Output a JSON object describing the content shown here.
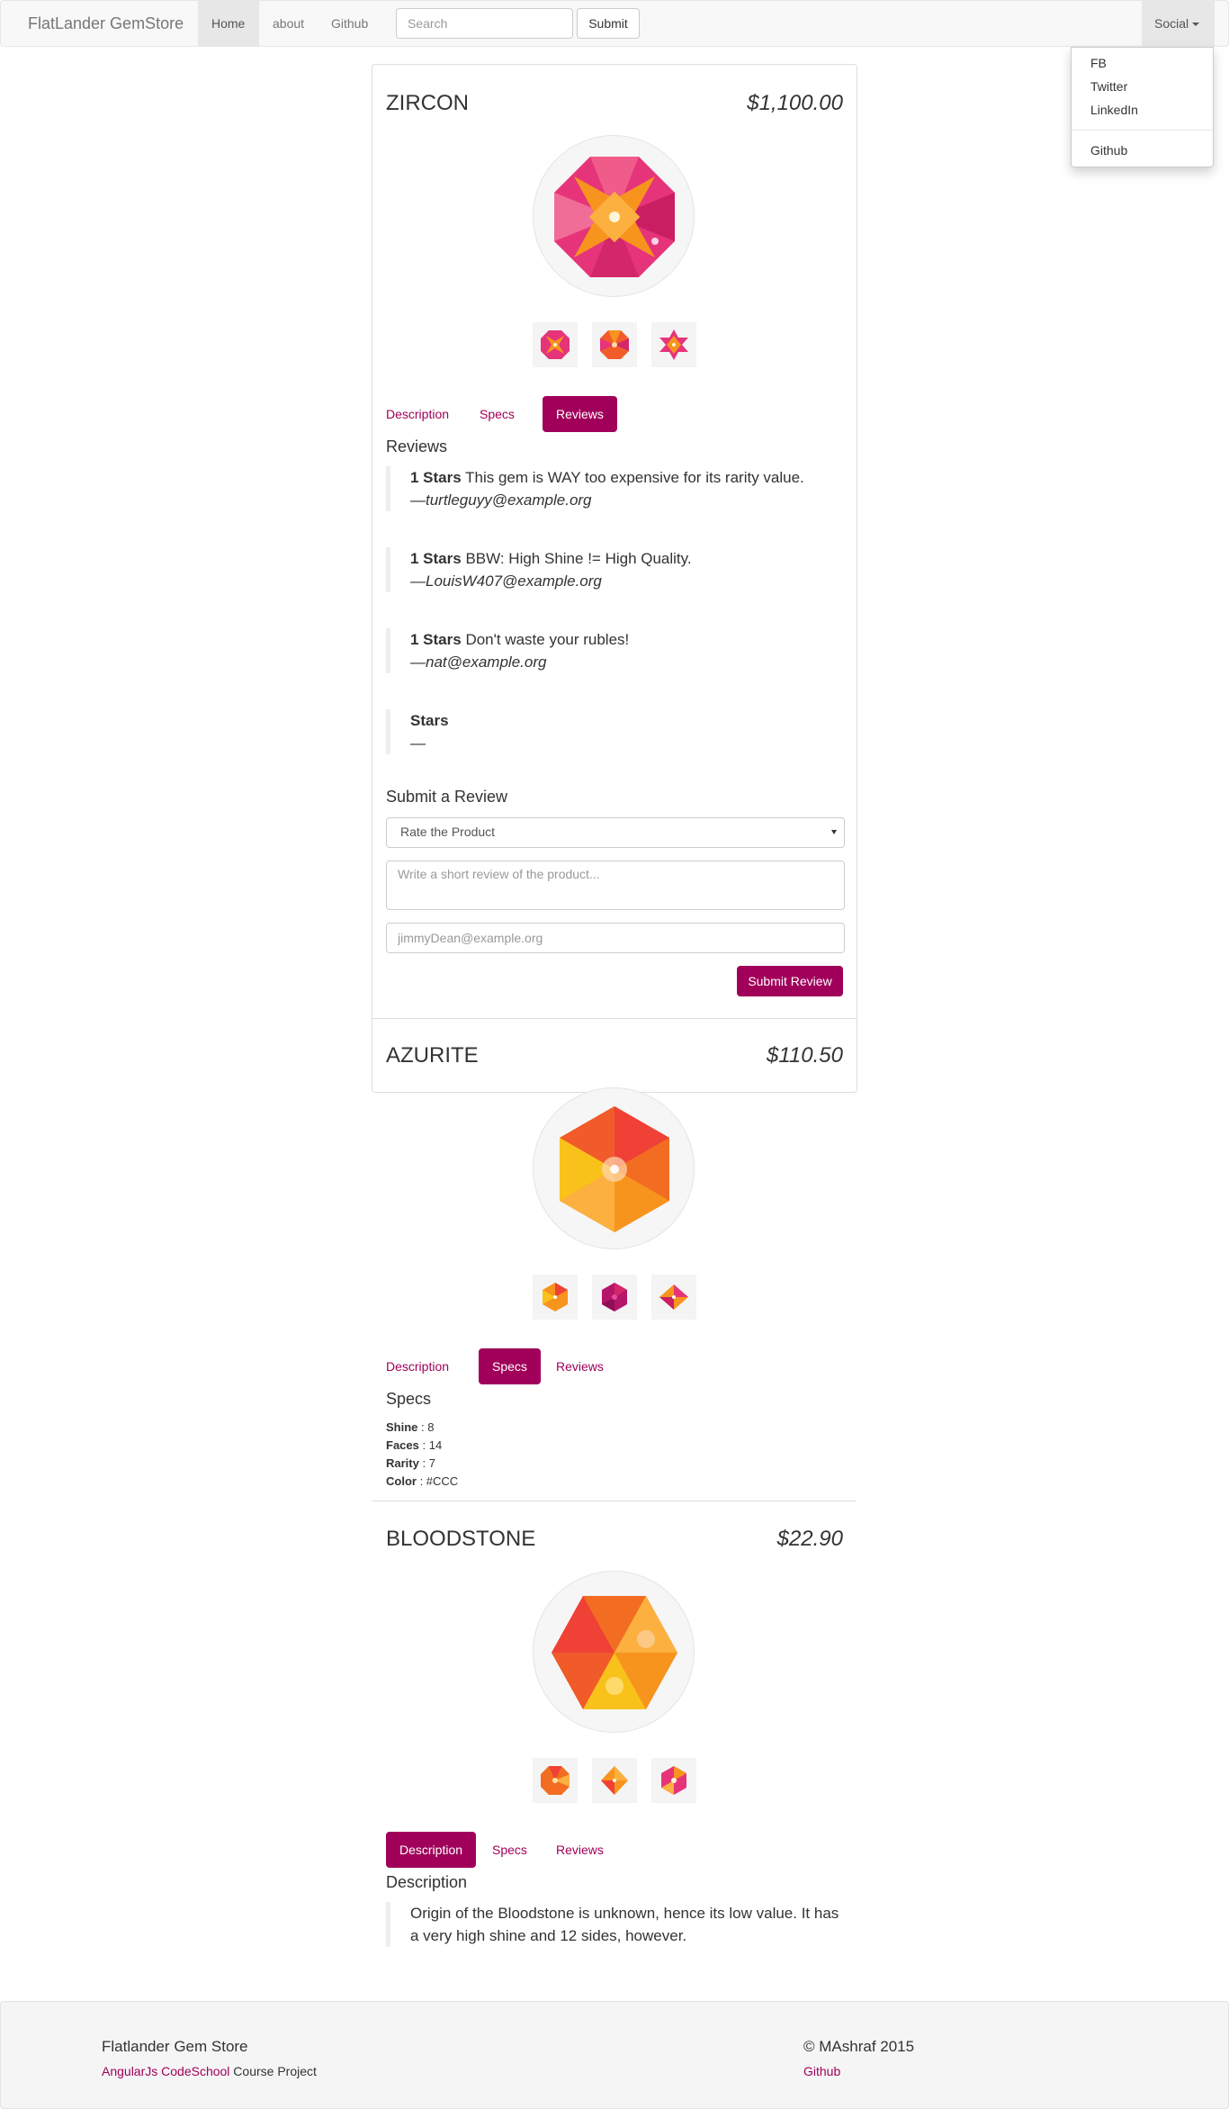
{
  "navbar": {
    "brand": "FlatLander GemStore",
    "home": "Home",
    "about": "about",
    "github": "Github",
    "search_placeholder": "Search",
    "submit": "Submit",
    "social": "Social"
  },
  "social_menu": {
    "items": [
      "FB",
      "Twitter",
      "LinkedIn"
    ],
    "extra": "Github"
  },
  "tabs": {
    "description": "Description",
    "specs": "Specs",
    "reviews": "Reviews"
  },
  "products": [
    {
      "name": "ZIRCON",
      "price": "$1,100.00",
      "active_tab": "reviews",
      "section_title": "Reviews",
      "reviews": [
        {
          "stars": "1 Stars",
          "body": "This gem is WAY too expensive for its rarity value.",
          "author": "—turtleguyy@example.org"
        },
        {
          "stars": "1 Stars",
          "body": "BBW: High Shine != High Quality.",
          "author": "—LouisW407@example.org"
        },
        {
          "stars": "1 Stars",
          "body": "Don't waste your rubles!",
          "author": "—nat@example.org"
        },
        {
          "stars": "Stars",
          "body": "",
          "author": "—"
        }
      ],
      "form": {
        "title": "Submit a Review",
        "rate_label": "Rate the Product",
        "review_placeholder": "Write a short review of the product...",
        "email_placeholder": "jimmyDean@example.org",
        "submit_label": "Submit Review"
      }
    },
    {
      "name": "AZURITE",
      "price": "$110.50",
      "active_tab": "specs",
      "section_title": "Specs",
      "specs": [
        {
          "label": "Shine",
          "value": " : 8"
        },
        {
          "label": "Faces",
          "value": " : 14"
        },
        {
          "label": "Rarity",
          "value": " : 7"
        },
        {
          "label": "Color",
          "value": " : #CCC"
        }
      ]
    },
    {
      "name": "BLOODSTONE",
      "price": "$22.90",
      "active_tab": "description",
      "section_title": "Description",
      "description": "Origin of the Bloodstone is unknown, hence its low value. It has a very high shine and 12 sides, however."
    }
  ],
  "footer": {
    "title": "Flatlander Gem Store",
    "sub_link": "AngularJs CodeSchool",
    "sub_text": " Course Project",
    "copyright": "© MAshraf 2015",
    "github": "Github"
  },
  "colors": {
    "accent": "#a0005a",
    "navbar_bg": "#f8f8f8",
    "footer_bg": "#f5f5f5"
  }
}
